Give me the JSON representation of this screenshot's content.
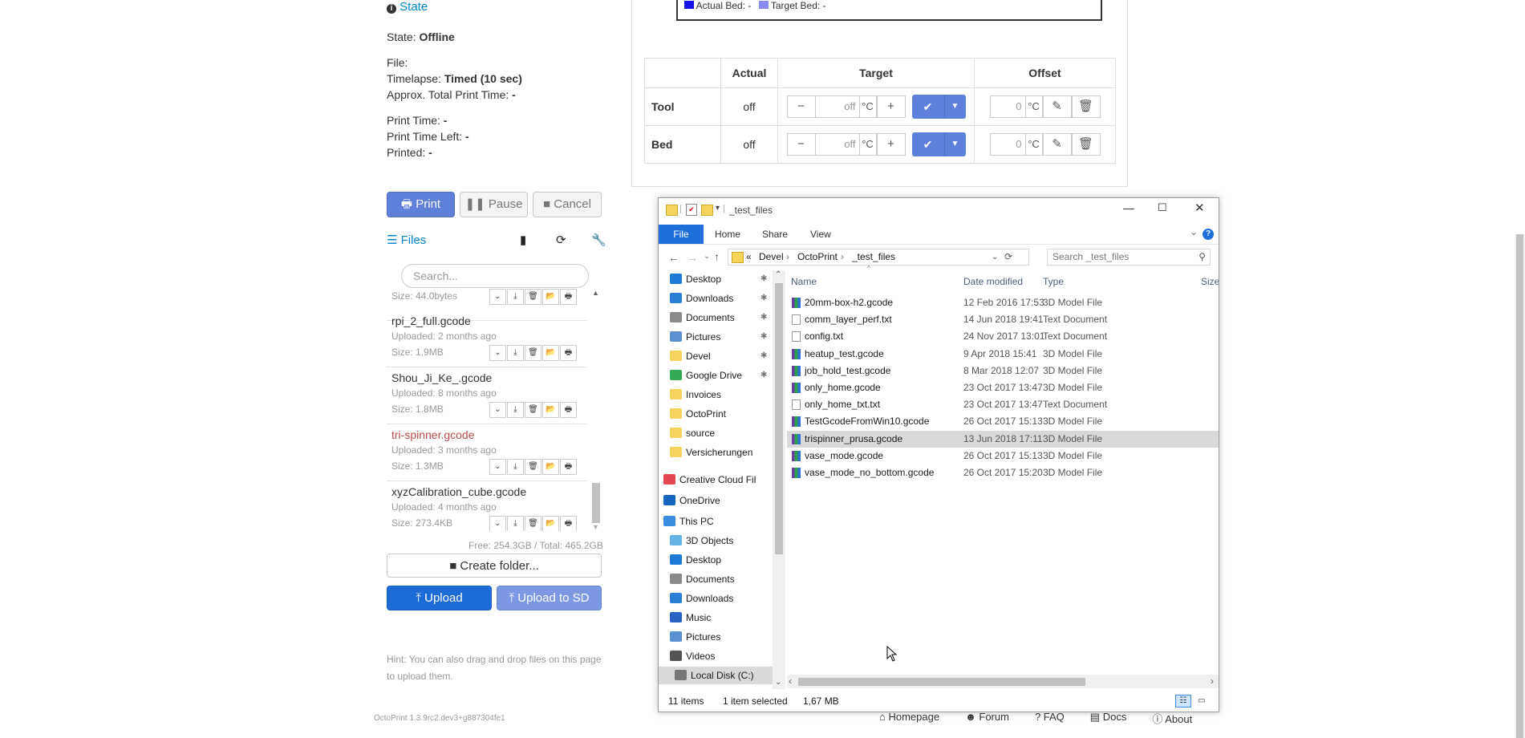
{
  "state_panel": {
    "heading": "State",
    "state_label": "State:",
    "state_value": "Offline",
    "file_label": "File:",
    "timelapse_label": "Timelapse:",
    "timelapse_value": "Timed (10 sec)",
    "approx_label": "Approx. Total Print Time:",
    "approx_value": "-",
    "print_time_label": "Print Time:",
    "print_time_value": "-",
    "time_left_label": "Print Time Left:",
    "time_left_value": "-",
    "printed_label": "Printed:",
    "printed_value": "-",
    "print_button": "Print",
    "pause_button": "Pause",
    "cancel_button": "Cancel"
  },
  "files_panel": {
    "heading": "Files",
    "search_placeholder": "Search...",
    "top_size": "Size: 44.0bytes",
    "files": [
      {
        "name": "rpi_2_full.gcode",
        "uploaded": "Uploaded: 2 months ago",
        "size": "Size: 1.9MB",
        "highlight": false
      },
      {
        "name": "Shou_Ji_Ke_.gcode",
        "uploaded": "Uploaded: 8 months ago",
        "size": "Size: 1.8MB",
        "highlight": false
      },
      {
        "name": "tri-spinner.gcode",
        "uploaded": "Uploaded: 3 months ago",
        "size": "Size: 1.3MB",
        "highlight": true
      },
      {
        "name": "xyzCalibration_cube.gcode",
        "uploaded": "Uploaded: 4 months ago",
        "size": "Size: 273.4KB",
        "highlight": false
      }
    ],
    "free_total": "Free: 254.3GB / Total: 465.2GB",
    "create_folder": "Create folder...",
    "upload": "Upload",
    "upload_sd": "Upload to SD",
    "hint": "Hint: You can also drag and drop files on this page to upload them."
  },
  "version": "OctoPrint 1.3.9rc2.dev3+g887304fe1",
  "temperature": {
    "legend_actual_bed": "Actual Bed: -",
    "legend_target_bed": "Target Bed: -",
    "headers": [
      "Actual",
      "Target",
      "Offset"
    ],
    "rows": [
      {
        "name": "Tool",
        "actual": "off",
        "target": "off",
        "unit": "°C",
        "offset": "0"
      },
      {
        "name": "Bed",
        "actual": "off",
        "target": "off",
        "unit": "°C",
        "offset": "0"
      }
    ]
  },
  "explorer": {
    "title": "_test_files",
    "ribbon_tabs": [
      "File",
      "Home",
      "Share",
      "View"
    ],
    "breadcrumb": [
      "«",
      "Devel",
      "OctoPrint",
      "_test_files"
    ],
    "search_placeholder": "Search _test_files",
    "nav_items": [
      {
        "label": "Desktop",
        "icon": "desktop-icon",
        "pinned": true
      },
      {
        "label": "Downloads",
        "icon": "downloads-icon",
        "pinned": true
      },
      {
        "label": "Documents",
        "icon": "documents-icon",
        "pinned": true
      },
      {
        "label": "Pictures",
        "icon": "pictures-icon",
        "pinned": true
      },
      {
        "label": "Devel",
        "icon": "folder-icon",
        "pinned": true
      },
      {
        "label": "Google Drive",
        "icon": "google-drive-icon",
        "pinned": true
      },
      {
        "label": "Invoices",
        "icon": "folder-check-icon",
        "pinned": false
      },
      {
        "label": "OctoPrint",
        "icon": "folder-icon",
        "pinned": false
      },
      {
        "label": "source",
        "icon": "folder-icon",
        "pinned": false
      },
      {
        "label": "Versicherungen",
        "icon": "folder-check-icon",
        "pinned": false
      },
      {
        "label": "Creative Cloud Fil",
        "icon": "creative-cloud-icon",
        "pinned": false
      },
      {
        "label": "OneDrive",
        "icon": "onedrive-icon",
        "pinned": false
      },
      {
        "label": "This PC",
        "icon": "this-pc-icon",
        "pinned": false
      },
      {
        "label": "3D Objects",
        "icon": "3d-objects-icon",
        "pinned": false
      },
      {
        "label": "Desktop",
        "icon": "desktop-icon",
        "pinned": false
      },
      {
        "label": "Documents",
        "icon": "documents-icon",
        "pinned": false
      },
      {
        "label": "Downloads",
        "icon": "downloads-icon",
        "pinned": false
      },
      {
        "label": "Music",
        "icon": "music-icon",
        "pinned": false
      },
      {
        "label": "Pictures",
        "icon": "pictures-icon",
        "pinned": false
      },
      {
        "label": "Videos",
        "icon": "videos-icon",
        "pinned": false
      },
      {
        "label": "Local Disk (C:)",
        "icon": "local-disk-icon",
        "pinned": false
      }
    ],
    "columns": [
      "Name",
      "Date modified",
      "Type",
      "Size"
    ],
    "files": [
      {
        "name": "20mm-box-h2.gcode",
        "date": "12 Feb 2016 17:53",
        "type": "3D Model File",
        "icon": "3d-model-icon"
      },
      {
        "name": "comm_layer_perf.txt",
        "date": "14 Jun 2018 19:41",
        "type": "Text Document",
        "icon": "text-document-icon"
      },
      {
        "name": "config.txt",
        "date": "24 Nov 2017 13:01",
        "type": "Text Document",
        "icon": "text-document-icon"
      },
      {
        "name": "heatup_test.gcode",
        "date": "9 Apr 2018 15:41",
        "type": "3D Model File",
        "icon": "3d-model-icon"
      },
      {
        "name": "job_hold_test.gcode",
        "date": "8 Mar 2018 12:07",
        "type": "3D Model File",
        "icon": "3d-model-icon"
      },
      {
        "name": "only_home.gcode",
        "date": "23 Oct 2017 13:47",
        "type": "3D Model File",
        "icon": "3d-model-icon"
      },
      {
        "name": "only_home_txt.txt",
        "date": "23 Oct 2017 13:47",
        "type": "Text Document",
        "icon": "text-document-icon"
      },
      {
        "name": "TestGcodeFromWin10.gcode",
        "date": "26 Oct 2017 15:13",
        "type": "3D Model File",
        "icon": "3d-model-icon"
      },
      {
        "name": "trispinner_prusa.gcode",
        "date": "13 Jun 2018 17:11",
        "type": "3D Model File",
        "icon": "3d-model-icon",
        "selected": true
      },
      {
        "name": "vase_mode.gcode",
        "date": "26 Oct 2017 15:13",
        "type": "3D Model File",
        "icon": "3d-model-icon"
      },
      {
        "name": "vase_mode_no_bottom.gcode",
        "date": "26 Oct 2017 15:20",
        "type": "3D Model File",
        "icon": "3d-model-icon"
      }
    ],
    "status_items": "11 items",
    "status_selected": "1 item selected",
    "status_size": "1,67 MB"
  },
  "footer_links": [
    "Homepage",
    "Forum",
    "FAQ",
    "Docs",
    "About"
  ],
  "colors": {
    "primary": "#5d80d8",
    "upload": "#1c6bd6",
    "link": "#0088cc",
    "highlight_file": "#b94a48",
    "explorer_file_tab": "#1e6fd9",
    "actual_bed": "#1414e6",
    "target_bed": "#8b8bf5"
  }
}
